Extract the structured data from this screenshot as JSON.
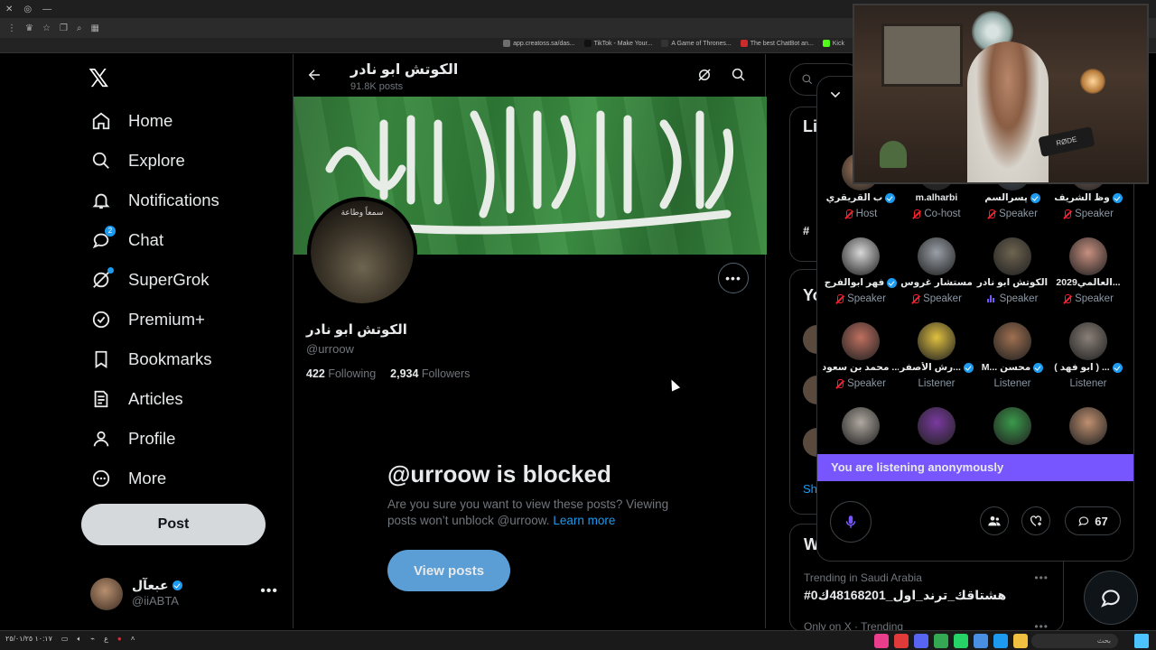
{
  "bookmarks": [
    {
      "label": "app.creatoss.sa/das...",
      "color": "#6d6d6d"
    },
    {
      "label": "TikTok - Make Your...",
      "color": "#111111"
    },
    {
      "label": "A Game of Thrones...",
      "color": "#333333"
    },
    {
      "label": "The best ChatBot an...",
      "color": "#cc2b2b"
    },
    {
      "label": "Kick",
      "color": "#53fc18"
    }
  ],
  "nav": {
    "items": [
      {
        "label": "Home",
        "icon": "home-icon"
      },
      {
        "label": "Explore",
        "icon": "search-icon"
      },
      {
        "label": "Notifications",
        "icon": "bell-icon"
      },
      {
        "label": "Chat",
        "icon": "chat-icon",
        "badge": "2"
      },
      {
        "label": "SuperGrok",
        "icon": "grok-icon"
      },
      {
        "label": "Premium+",
        "icon": "premium-icon"
      },
      {
        "label": "Bookmarks",
        "icon": "bookmark-icon"
      },
      {
        "label": "Articles",
        "icon": "articles-icon"
      },
      {
        "label": "Profile",
        "icon": "profile-icon"
      },
      {
        "label": "More",
        "icon": "more-icon"
      }
    ],
    "post_label": "Post"
  },
  "account": {
    "name": "عبعآل",
    "handle": "@iiABTA"
  },
  "profile": {
    "header_name": "الكوتش ابو نادر",
    "post_count": "91.8K posts",
    "avatar_text": "سمعاً وطاعة",
    "name": "الكوتش ابو نادر",
    "handle": "@urroow",
    "following_count": "422",
    "following_label": "Following",
    "followers_count": "2,934",
    "followers_label": "Followers",
    "blocked_title": "@urroow is blocked",
    "blocked_msg": "Are you sure you want to view these posts? Viewing posts won’t unblock @urroow.",
    "learn_more": "Learn more",
    "view_posts": "View posts"
  },
  "right": {
    "partial_1": "Li",
    "partial_2": "Yo",
    "partial_3": "Sh",
    "partial_4": "#",
    "trend_head": "W",
    "trend_meta": "Trending in Saudi Arabia",
    "trend_tag": "#هشتاقك_ترند_اول_48168201ك0",
    "trend_meta2": "Only on X · Trending"
  },
  "spaces": {
    "participants": [
      {
        "name": "ب القريقري",
        "role": "Host",
        "verified": true,
        "role_icon": "micoff",
        "color": "#b08060"
      },
      {
        "name": "m.alharbi",
        "role": "Co-host",
        "verified": false,
        "role_icon": "micoff",
        "color": "#2a2a2a"
      },
      {
        "name": "پسرالسم",
        "role": "Speaker",
        "verified": true,
        "role_icon": "micoff",
        "color": "#4a5a6a"
      },
      {
        "name": "وظ الشريف",
        "role": "Speaker",
        "verified": true,
        "role_icon": "micoff",
        "color": "#8a7060"
      },
      {
        "name": "فهر ابوالفرج",
        "role": "Speaker",
        "verified": true,
        "role_icon": "micoff",
        "color": "#d8d8d8"
      },
      {
        "name": "مستشار غروس",
        "role": "Speaker",
        "verified": false,
        "role_icon": "micoff",
        "color": "#9aa0a8"
      },
      {
        "name": "الكوتش ابو نادر",
        "role": "Speaker",
        "verified": false,
        "role_icon": "eq",
        "color": "#6e6450"
      },
      {
        "name": "العالمي2029...",
        "role": "Speaker",
        "verified": false,
        "role_icon": "micoff",
        "color": "#c89080"
      },
      {
        "name": "محمد بن سعود ...",
        "role": "Speaker",
        "verified": false,
        "role_icon": "micoff",
        "color": "#c07060"
      },
      {
        "name": "رش الأصفر...",
        "role": "Listener",
        "verified": true,
        "role_icon": "",
        "color": "#e0c040"
      },
      {
        "name": "M... محسن",
        "role": "Listener",
        "verified": true,
        "role_icon": "",
        "color": "#a07050"
      },
      {
        "name": "( ابو فهد ) ...",
        "role": "Listener",
        "verified": true,
        "role_icon": "",
        "color": "#8a8078"
      },
      {
        "name": "",
        "role": "",
        "verified": false,
        "role_icon": "",
        "color": "#b0a8a0"
      },
      {
        "name": "",
        "role": "",
        "verified": false,
        "role_icon": "",
        "color": "#7a3aa0"
      },
      {
        "name": "",
        "role": "",
        "verified": false,
        "role_icon": "",
        "color": "#3a9a4a"
      },
      {
        "name": "",
        "role": "",
        "verified": false,
        "role_icon": "",
        "color": "#c09070"
      }
    ],
    "listening_text": "You are listening anonymously",
    "reply_count": "67"
  },
  "webcam": {
    "mic_label": "RØDE"
  },
  "taskbar": {
    "time": "١٠:١٧",
    "date": "٢٥/٠١/٢٥",
    "search_placeholder": "بحث"
  },
  "colors": {
    "accent": "#1d9bf0",
    "spaces_purple": "#7856ff",
    "mute_red": "#f4212e"
  }
}
